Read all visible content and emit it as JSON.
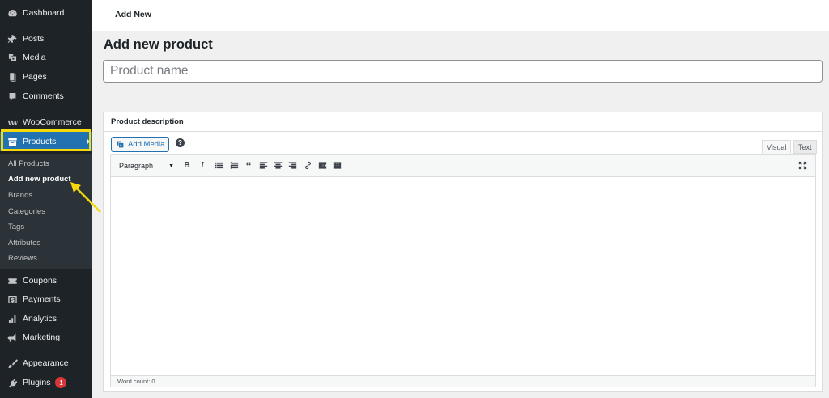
{
  "sidebar": {
    "items": [
      {
        "label": "Dashboard",
        "icon": "dashboard-icon"
      },
      {
        "label": "Posts",
        "icon": "pin-icon"
      },
      {
        "label": "Media",
        "icon": "media-icon"
      },
      {
        "label": "Pages",
        "icon": "pages-icon"
      },
      {
        "label": "Comments",
        "icon": "comment-icon"
      },
      {
        "label": "WooCommerce",
        "icon": "woocommerce-icon"
      },
      {
        "label": "Products",
        "icon": "archive-icon"
      },
      {
        "label": "Coupons",
        "icon": "ticket-icon"
      },
      {
        "label": "Payments",
        "icon": "payments-icon"
      },
      {
        "label": "Analytics",
        "icon": "analytics-icon"
      },
      {
        "label": "Marketing",
        "icon": "megaphone-icon"
      },
      {
        "label": "Appearance",
        "icon": "brush-icon"
      },
      {
        "label": "Plugins",
        "icon": "plug-icon",
        "badge": "1"
      }
    ],
    "submenu": [
      {
        "label": "All Products"
      },
      {
        "label": "Add new product",
        "current": true
      },
      {
        "label": "Brands"
      },
      {
        "label": "Categories"
      },
      {
        "label": "Tags"
      },
      {
        "label": "Attributes"
      },
      {
        "label": "Reviews"
      }
    ]
  },
  "topbar": {
    "title": "Add New"
  },
  "main": {
    "heading": "Add new product",
    "product_name_placeholder": "Product name",
    "description": {
      "header": "Product description",
      "add_media_label": "Add Media",
      "help_label": "?",
      "tabs": {
        "visual": "Visual",
        "text": "Text"
      },
      "format_select": "Paragraph",
      "toolbar": [
        "bold-icon",
        "italic-icon",
        "bulleted-list-icon",
        "numbered-list-icon",
        "blockquote-icon",
        "align-left-icon",
        "align-center-icon",
        "align-right-icon",
        "link-icon",
        "read-more-icon",
        "toolbar-toggle-icon",
        "fullscreen-icon"
      ],
      "bold_glyph": "B",
      "italic_glyph": "I",
      "quote_glyph": "“",
      "word_count": "Word count: 0"
    }
  },
  "colors": {
    "sidebar_bg": "#1d2327",
    "accent": "#2271b1",
    "highlight": "#f5d90a",
    "badge": "#d63638"
  }
}
